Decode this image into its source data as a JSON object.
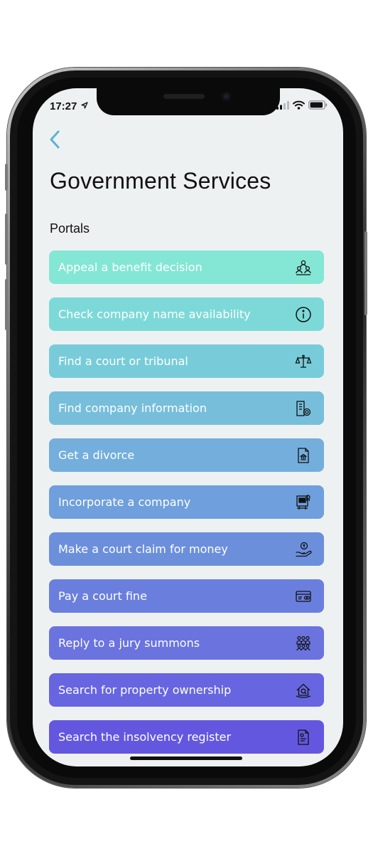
{
  "status_bar": {
    "time": "17:27"
  },
  "header": {
    "title": "Government Services"
  },
  "section": {
    "label": "Portals"
  },
  "portals": [
    {
      "label": "Appeal a benefit decision",
      "icon": "people-group-icon",
      "color": "#84e6d4"
    },
    {
      "label": "Check company name availability",
      "icon": "info-circle-icon",
      "color": "#7dd9d8"
    },
    {
      "label": "Find a court or tribunal",
      "icon": "scales-icon",
      "color": "#78ccd9"
    },
    {
      "label": "Find company information",
      "icon": "building-search-icon",
      "color": "#77bedb"
    },
    {
      "label": "Get a divorce",
      "icon": "document-courthouse-icon",
      "color": "#74aedc"
    },
    {
      "label": "Incorporate a company",
      "icon": "company-registration-icon",
      "color": "#6f9fdc"
    },
    {
      "label": "Make a court claim for money",
      "icon": "hand-coin-icon",
      "color": "#6c8fdc"
    },
    {
      "label": "Pay a court fine",
      "icon": "payment-card-icon",
      "color": "#6a7fdd"
    },
    {
      "label": "Reply to a jury summons",
      "icon": "jury-group-icon",
      "color": "#6a73de"
    },
    {
      "label": "Search for property ownership",
      "icon": "house-search-icon",
      "color": "#6765df"
    },
    {
      "label": "Search the insolvency register",
      "icon": "register-document-icon",
      "color": "#6457df"
    }
  ]
}
